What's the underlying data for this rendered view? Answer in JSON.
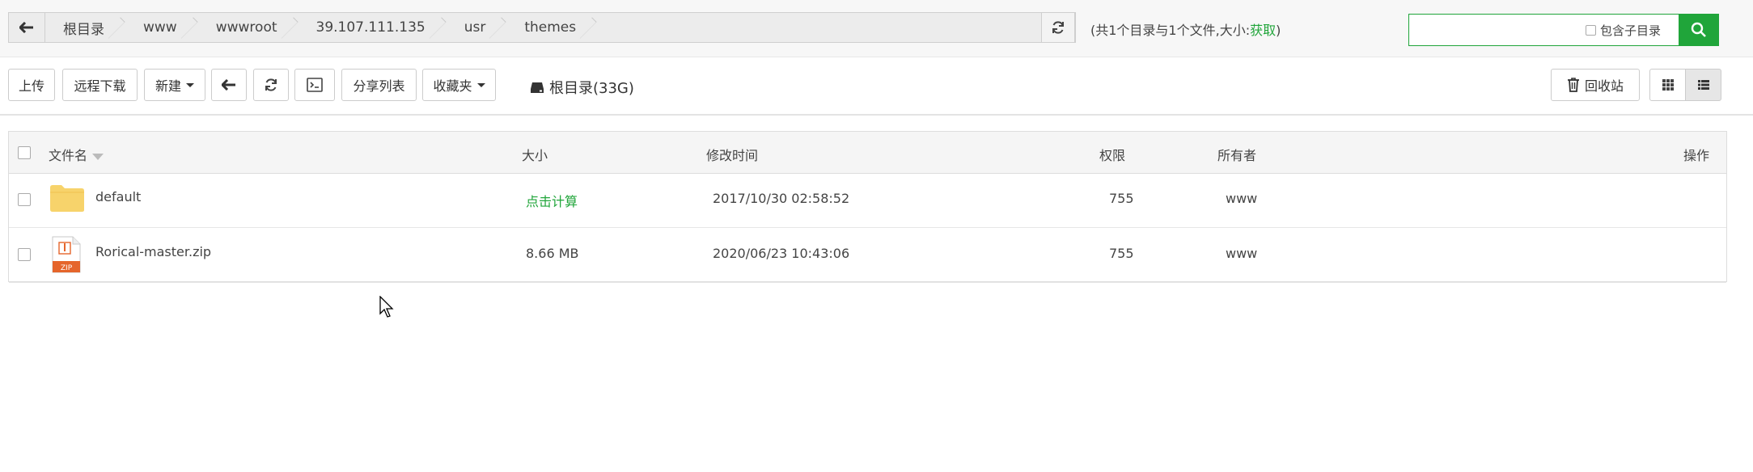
{
  "breadcrumb": {
    "items": [
      "根目录",
      "www",
      "wwwroot",
      "39.107.111.135",
      "usr",
      "themes"
    ]
  },
  "summary": {
    "text": "(共1个目录与1个文件,大小:",
    "link": "获取",
    "close": ")"
  },
  "search": {
    "value": "",
    "subdir_label": "包含子目录"
  },
  "toolbar": {
    "upload": "上传",
    "remote_download": "远程下载",
    "new": "新建",
    "share_list": "分享列表",
    "favorites": "收藏夹",
    "disk": "根目录(33G)",
    "recycle": "回收站"
  },
  "table": {
    "headers": {
      "name": "文件名",
      "size": "大小",
      "mtime": "修改时间",
      "perm": "权限",
      "owner": "所有者",
      "ops": "操作"
    },
    "rows": [
      {
        "name": "default",
        "size": "点击计算",
        "mtime": "2017/10/30 02:58:52",
        "perm": "755",
        "owner": "www",
        "type": "folder"
      },
      {
        "name": "Rorical-master.zip",
        "size": "8.66 MB",
        "mtime": "2020/06/23 10:43:06",
        "perm": "755",
        "owner": "www",
        "type": "zip"
      }
    ]
  },
  "icons": {
    "zip_label": "ZIP"
  },
  "colors": {
    "accent": "#20a53a",
    "folder": "#f7d36b",
    "zip": "#e5652b"
  }
}
